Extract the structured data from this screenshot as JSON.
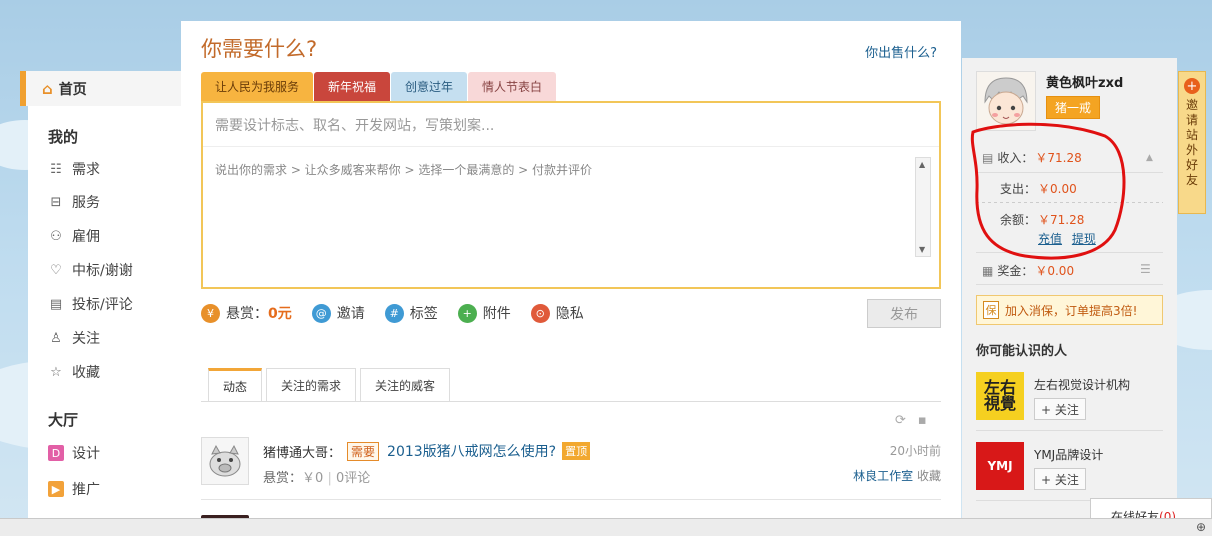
{
  "left_nav": {
    "home_label": "首页",
    "group_mine": "我的",
    "items_mine": [
      {
        "icon": "list-icon",
        "label": "需求"
      },
      {
        "icon": "briefcase-icon",
        "label": "服务"
      },
      {
        "icon": "people-icon",
        "label": "雇佣"
      },
      {
        "icon": "heart-icon",
        "label": "中标/谢谢"
      },
      {
        "icon": "comment-icon",
        "label": "投标/评论"
      },
      {
        "icon": "user-icon",
        "label": "关注"
      },
      {
        "icon": "star-icon",
        "label": "收藏"
      }
    ],
    "group_hall": "大厅",
    "items_hall": [
      {
        "icon": "design-icon",
        "label": "设计",
        "color": "#e25fa6"
      },
      {
        "icon": "promo-icon",
        "label": "推广",
        "color": "#f2a23a"
      }
    ]
  },
  "main": {
    "title": "你需要什么?",
    "sell_link": "你出售什么?",
    "tabs": [
      "让人民为我服务",
      "新年祝福",
      "创意过年",
      "情人节表白"
    ],
    "input_placeholder": "需要设计标志、取名、开发网站，写策划案...",
    "steps": "说出你的需求  > 让众多威客来帮你  > 选择一个最满意的  > 付款并评价",
    "options": {
      "reward_label": "悬赏：",
      "reward_value": "0元",
      "invite": "邀请",
      "tags": "标签",
      "attach": "附件",
      "privacy": "隐私"
    },
    "publish_button": "发布",
    "feed_tabs": [
      "动态",
      "关注的需求",
      "关注的威客"
    ],
    "feed_item": {
      "user": "猪博通大哥：",
      "tag": "需要",
      "title": "2013版猪八戒网怎么使用?",
      "top_tag": "置顶",
      "reward_label": "悬赏：",
      "reward_value": "￥0",
      "comments": "0评论",
      "time": "20小时前",
      "studio": "林良工作室",
      "fav": "收藏"
    }
  },
  "right": {
    "user_name": "黄色枫叶zxd",
    "level": "猪一戒",
    "income_label": "收入：",
    "income_value": "￥71.28",
    "expense_label": "支出：",
    "expense_value": "￥0.00",
    "balance_label": "余额：",
    "balance_value": "￥71.28",
    "recharge": "充值",
    "withdraw": "提现",
    "bonus_label": "奖金：",
    "bonus_value": "￥0.00",
    "insurance": "加入消保，订单提高3倍!",
    "insurance_badge": "保",
    "know_title": "你可能认识的人",
    "people": [
      {
        "name": "左右视觉设计机构",
        "follow": "+ 关注"
      },
      {
        "name": "YMJ品牌设计",
        "follow": "+ 关注"
      }
    ]
  },
  "invite_tab": "邀请站外好友",
  "online": {
    "label": "在线好友",
    "count": "(0)"
  }
}
